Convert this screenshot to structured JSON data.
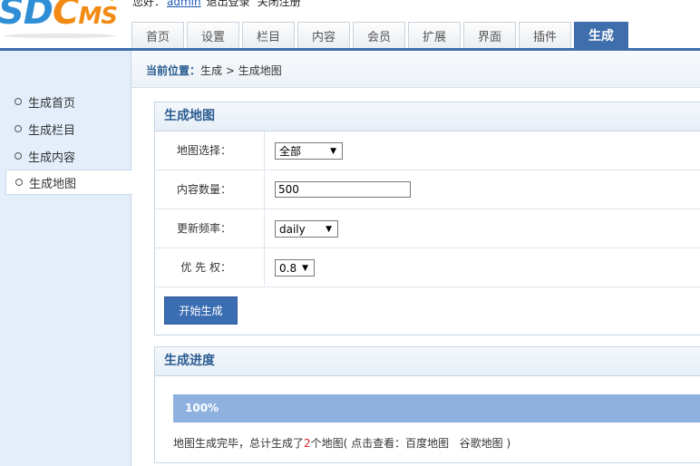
{
  "header": {
    "logo": {
      "part1": "SD",
      "part2": "C",
      "part3": "MS"
    },
    "userbar": {
      "greeting": "您好：",
      "username": "admin",
      "logout": "退出登录",
      "close_help": "关闭注册"
    }
  },
  "nav": {
    "tabs": [
      {
        "label": "首页",
        "active": false
      },
      {
        "label": "设置",
        "active": false
      },
      {
        "label": "栏目",
        "active": false
      },
      {
        "label": "内容",
        "active": false
      },
      {
        "label": "会员",
        "active": false
      },
      {
        "label": "扩展",
        "active": false
      },
      {
        "label": "界面",
        "active": false
      },
      {
        "label": "插件",
        "active": false
      },
      {
        "label": "生成",
        "active": true
      }
    ]
  },
  "sidebar": {
    "items": [
      {
        "label": "生成首页",
        "active": false
      },
      {
        "label": "生成栏目",
        "active": false
      },
      {
        "label": "生成内容",
        "active": false
      },
      {
        "label": "生成地图",
        "active": true
      }
    ]
  },
  "breadcrumb": {
    "label": "当前位置：",
    "path": "生成 > 生成地图"
  },
  "map_form": {
    "title": "生成地图",
    "map_select": {
      "label": "地图选择：",
      "value": "全部"
    },
    "content_count": {
      "label": "内容数量：",
      "value": "500"
    },
    "frequency": {
      "label": "更新频率：",
      "value": "daily"
    },
    "priority": {
      "label": "优 先 权：",
      "value": "0.8"
    },
    "submit_label": "开始生成"
  },
  "progress": {
    "title": "生成进度",
    "percent_text": "100%",
    "percent": 1.0,
    "msg_prefix": "地图生成完毕，总计生成了",
    "count": "2",
    "msg_suffix": "个地图(  点击查看：",
    "link_baidu": "百度地图",
    "link_google": "谷歌地图",
    "msg_end": "  )"
  },
  "colors": {
    "accent": "#3e6eab",
    "sidebar_bg": "#e3eefa",
    "progress_fill": "#8fb1e0",
    "count_red": "#dd2222"
  }
}
